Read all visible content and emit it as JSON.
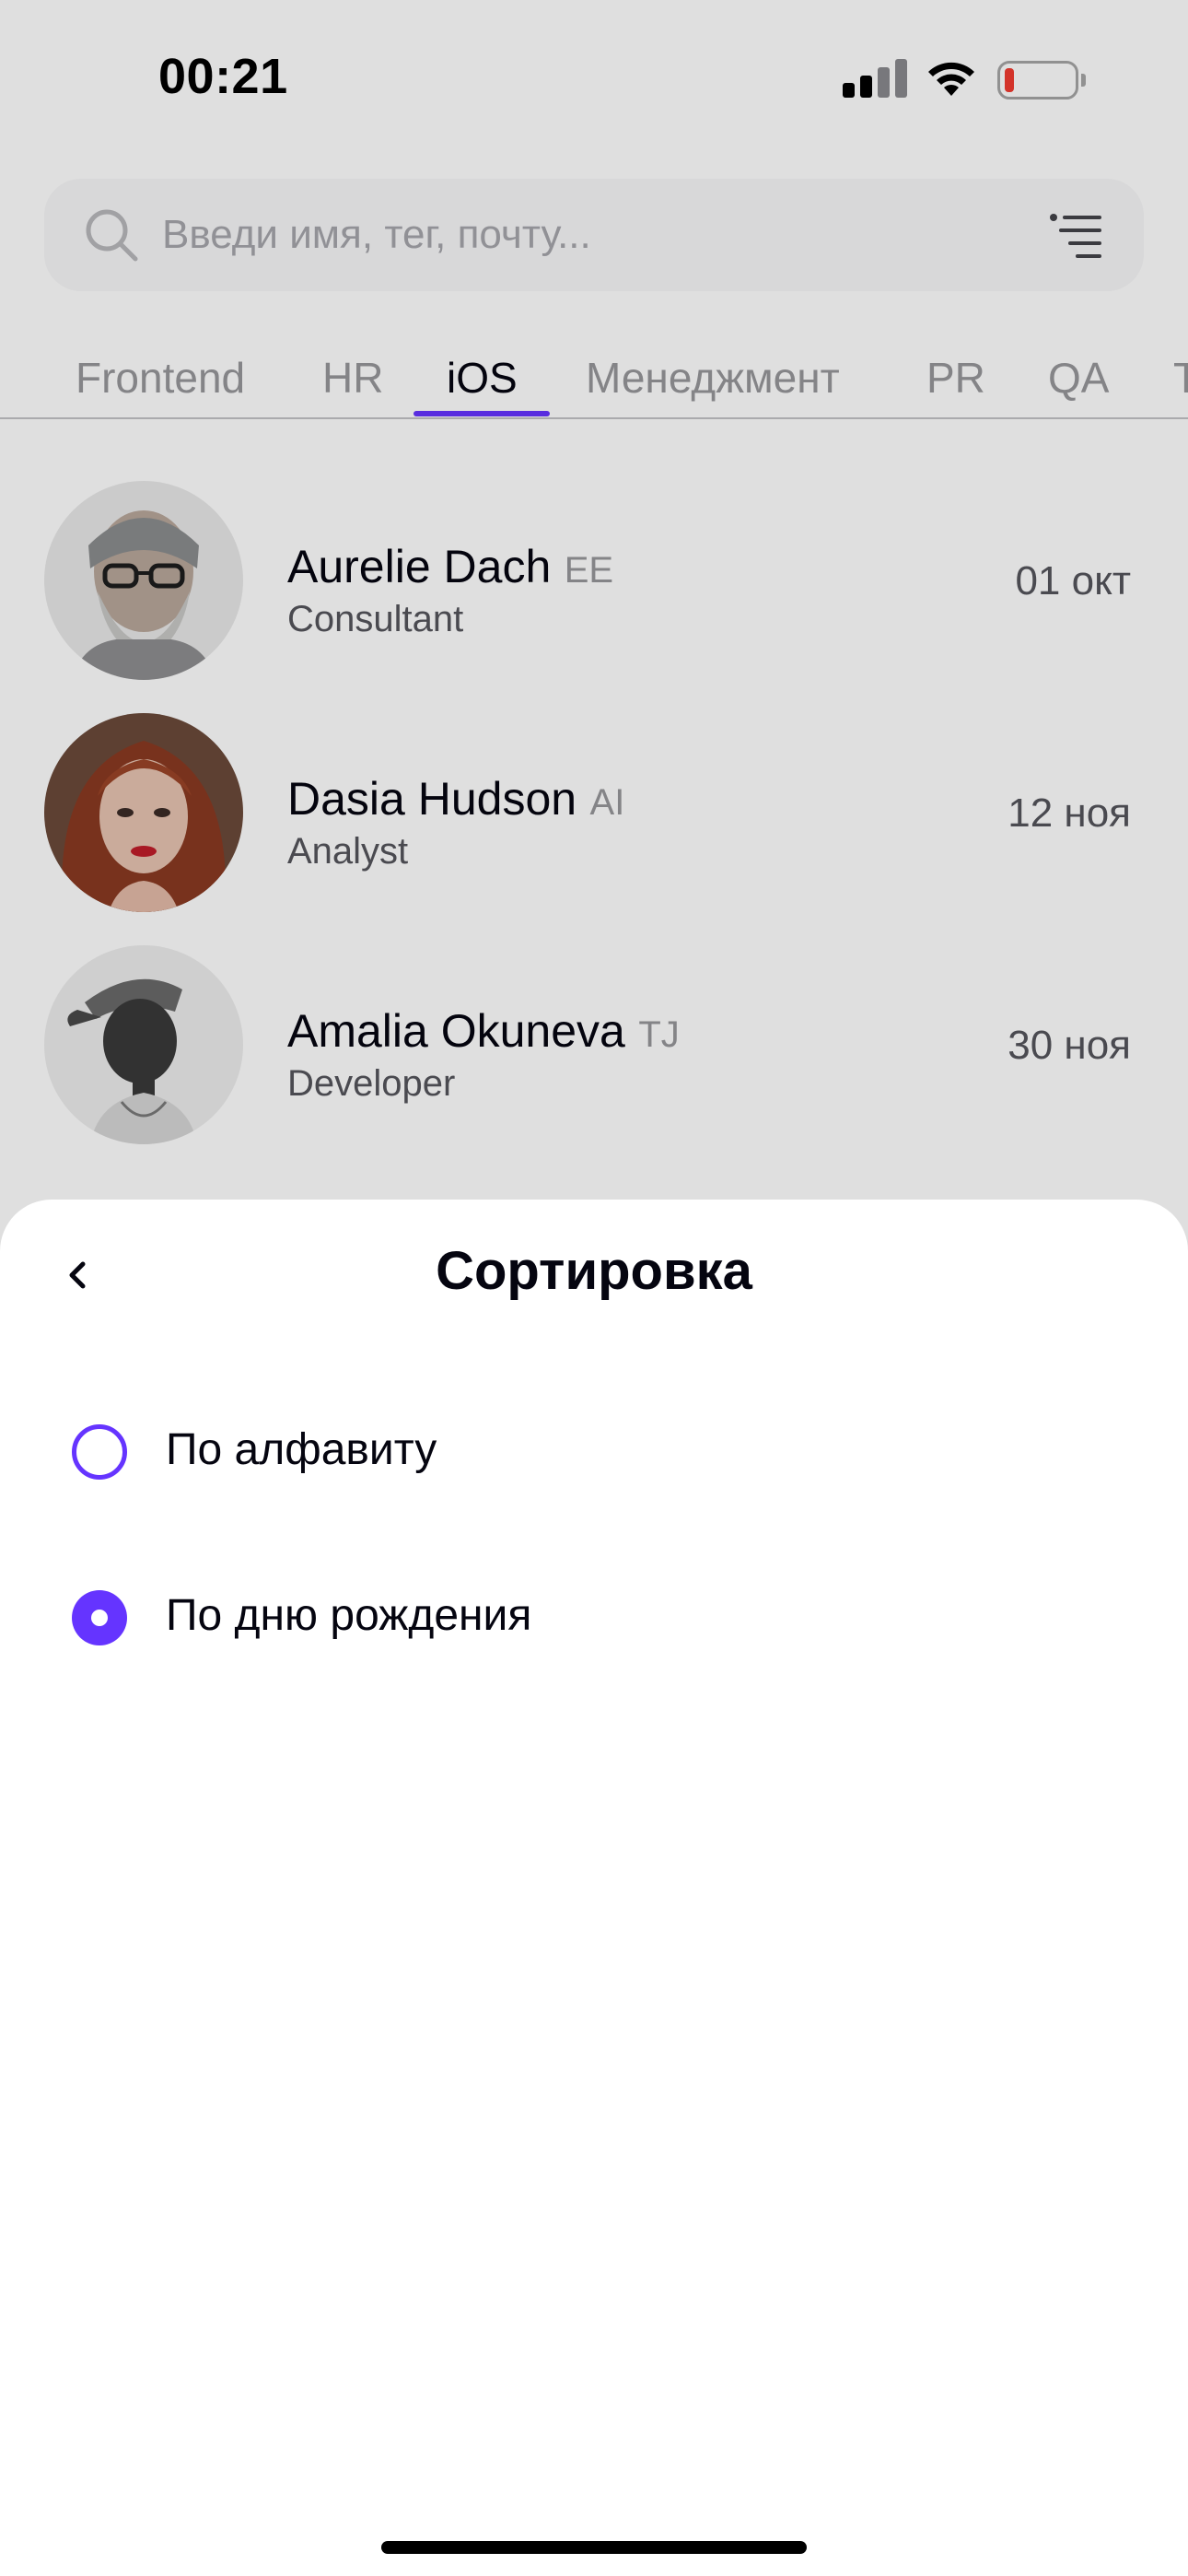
{
  "status_bar": {
    "time": "00:21",
    "battery_color": "#f23b30"
  },
  "search": {
    "placeholder": "Введи имя, тег, почту..."
  },
  "tabs": [
    {
      "label": "Frontend"
    },
    {
      "label": "HR"
    },
    {
      "label": "iOS",
      "active": true
    },
    {
      "label": "Менеджмент"
    },
    {
      "label": "PR"
    },
    {
      "label": "QA"
    },
    {
      "label": "T"
    }
  ],
  "employees": [
    {
      "name": "Aurelie Dach",
      "tag": "EE",
      "position": "Consultant",
      "date": "01 окт"
    },
    {
      "name": "Dasia Hudson",
      "tag": "AI",
      "position": "Analyst",
      "date": "12 ноя"
    },
    {
      "name": "Amalia Okuneva",
      "tag": "TJ",
      "position": "Developer",
      "date": "30 ноя"
    }
  ],
  "sort_sheet": {
    "title": "Сортировка",
    "options": [
      {
        "label": "По алфавиту",
        "selected": false
      },
      {
        "label": "По дню рождения",
        "selected": true
      }
    ]
  },
  "colors": {
    "accent": "#6534ff",
    "primary_text": "#050510",
    "secondary_text": "#97979b",
    "tertiary_text": "#55555c"
  }
}
